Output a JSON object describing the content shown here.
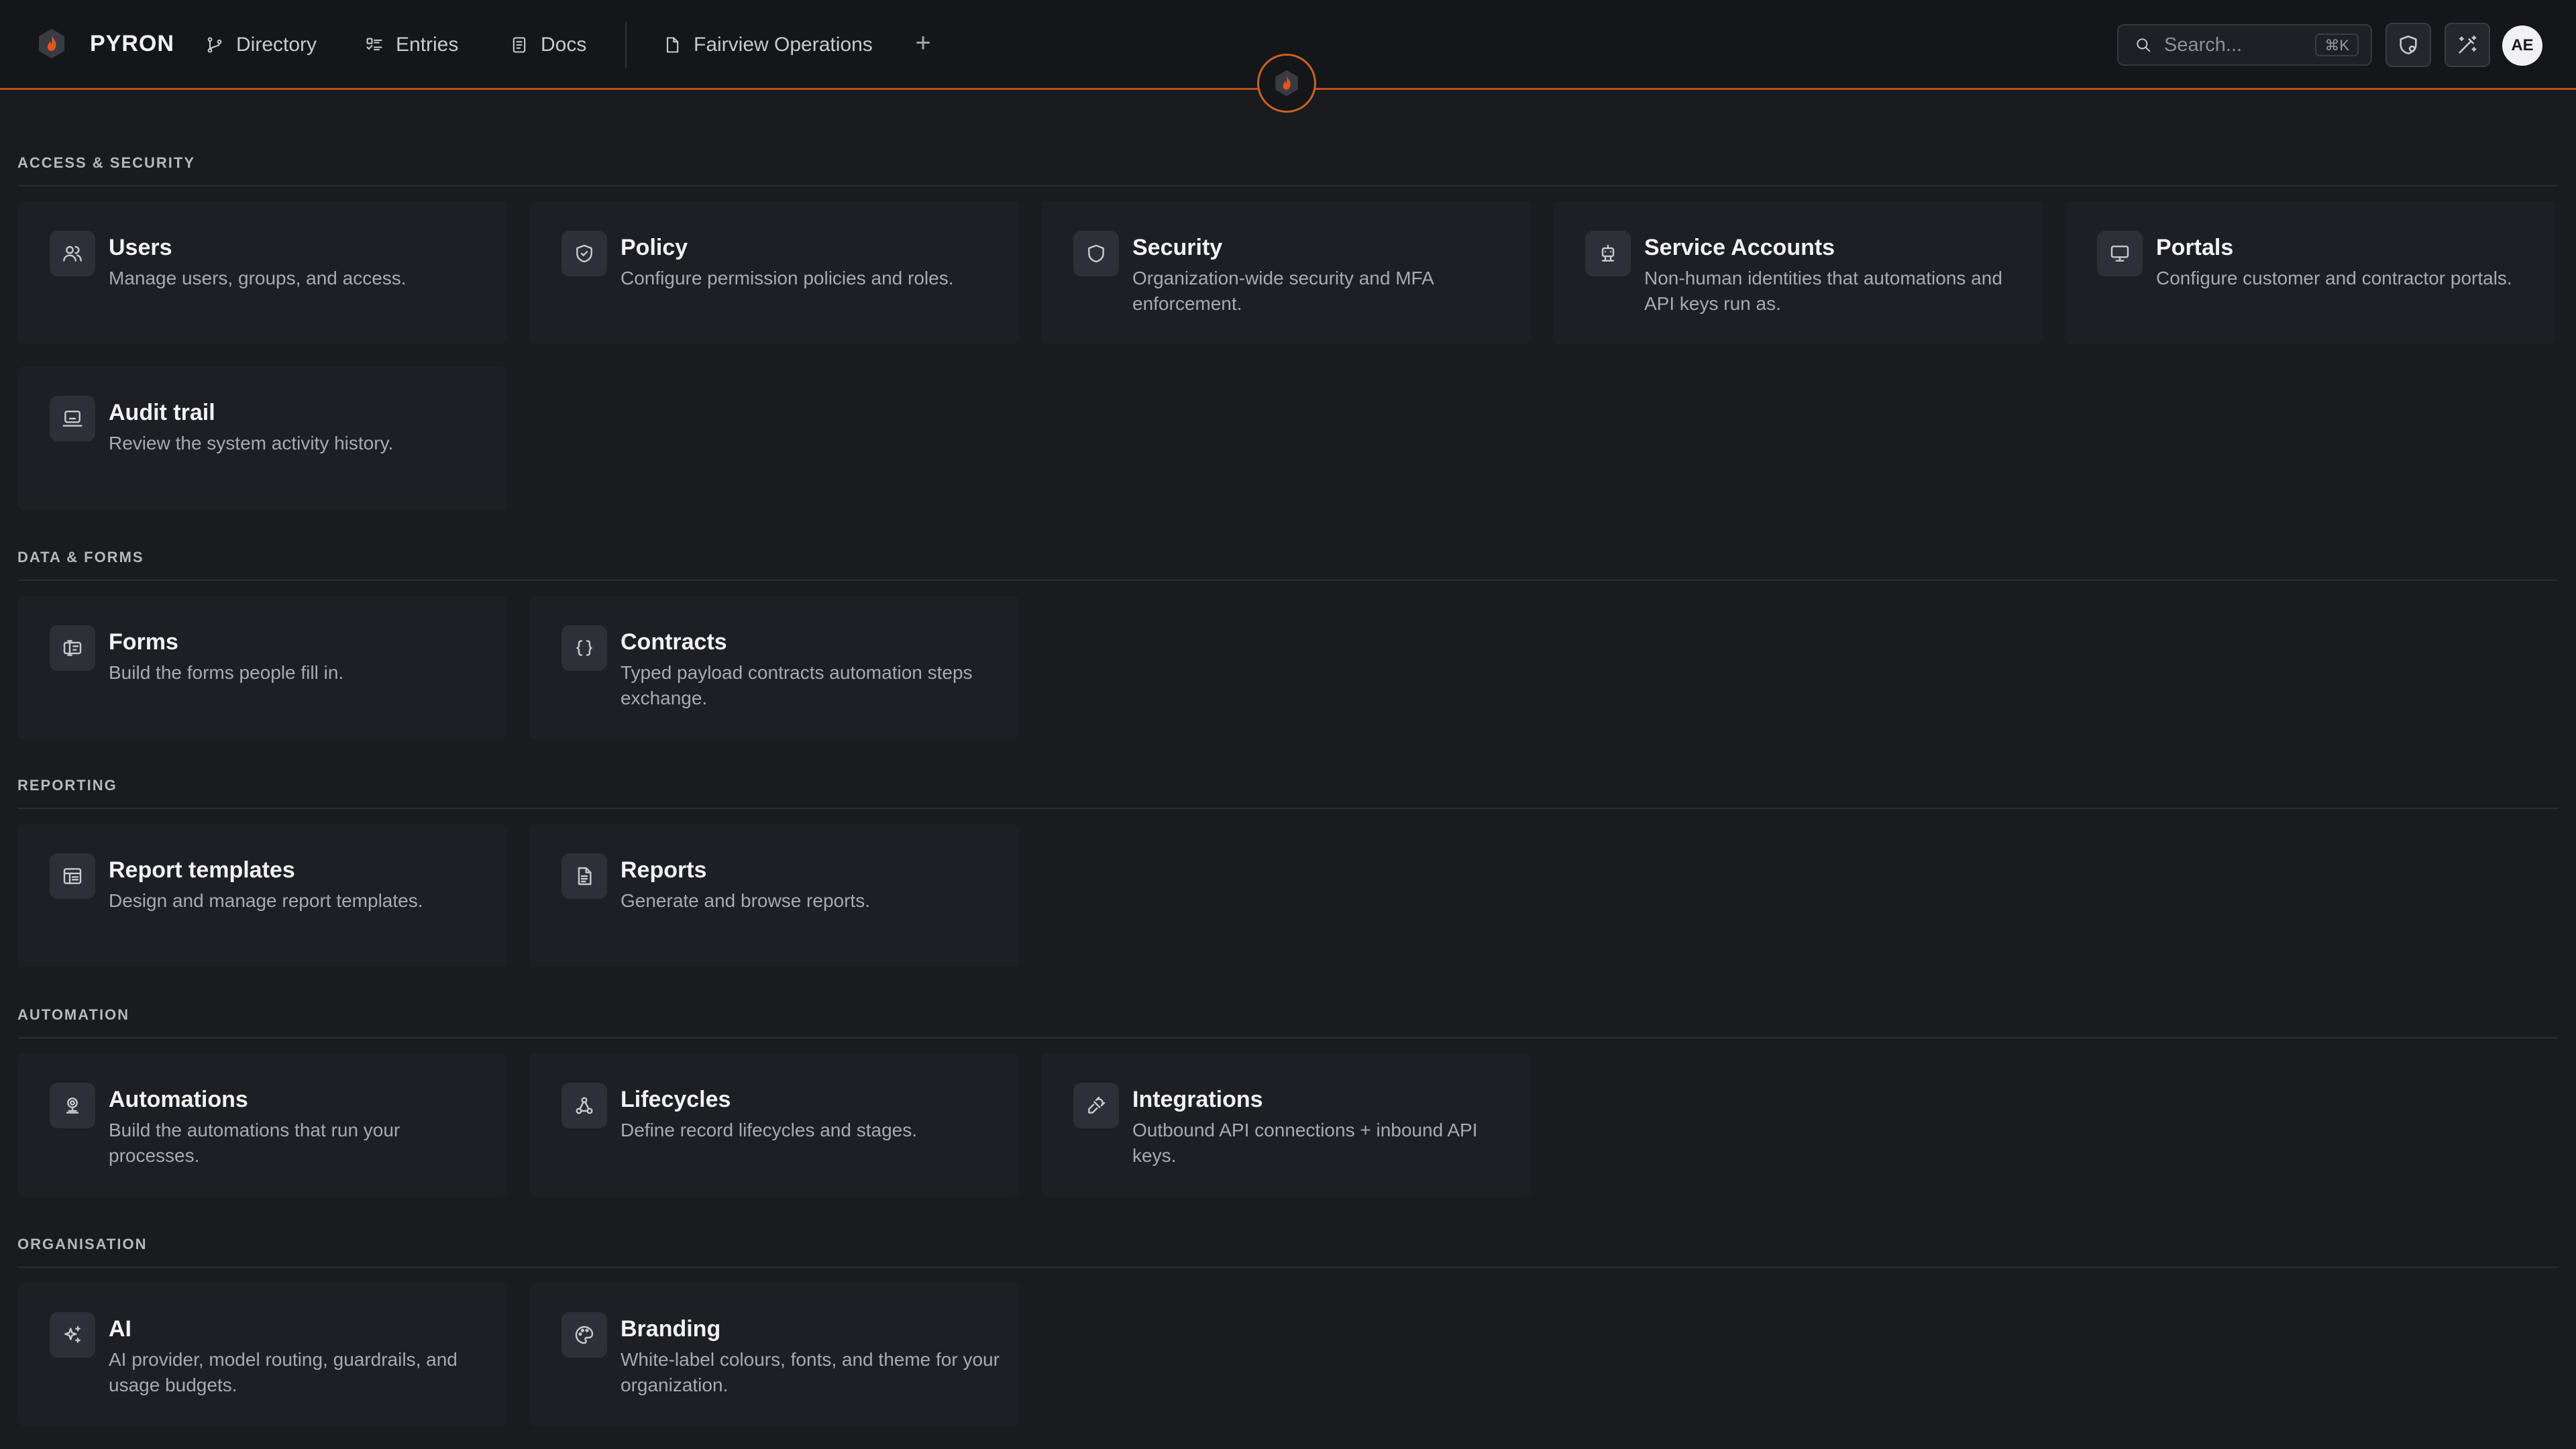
{
  "header": {
    "brand": "PYRON",
    "nav": [
      {
        "label": "Directory",
        "icon": "directory-icon"
      },
      {
        "label": "Entries",
        "icon": "entries-icon"
      },
      {
        "label": "Docs",
        "icon": "docs-icon"
      },
      {
        "label": "Fairview Operations",
        "icon": "file-icon"
      }
    ],
    "add_tab": "+",
    "search": {
      "placeholder": "Search...",
      "shortcut": "⌘K"
    },
    "avatar_initials": "AE",
    "accent_color": "#c8631f"
  },
  "sections": [
    {
      "title": "ACCESS & SECURITY",
      "cards": [
        {
          "title": "Users",
          "desc": "Manage users, groups, and access.",
          "icon": "users-icon"
        },
        {
          "title": "Policy",
          "desc": "Configure permission policies and roles.",
          "icon": "policy-shield-icon"
        },
        {
          "title": "Security",
          "desc": "Organization-wide security and MFA enforcement.",
          "icon": "shield-icon"
        },
        {
          "title": "Service Accounts",
          "desc": "Non-human identities that automations and API keys run as.",
          "icon": "robot-icon"
        },
        {
          "title": "Portals",
          "desc": "Configure customer and contractor portals.",
          "icon": "monitor-icon"
        },
        {
          "title": "Audit trail",
          "desc": "Review the system activity history.",
          "icon": "audit-icon"
        }
      ]
    },
    {
      "title": "DATA & FORMS",
      "cards": [
        {
          "title": "Forms",
          "desc": "Build the forms people fill in.",
          "icon": "form-icon"
        },
        {
          "title": "Contracts",
          "desc": "Typed payload contracts automation steps exchange.",
          "icon": "braces-icon"
        }
      ]
    },
    {
      "title": "REPORTING",
      "cards": [
        {
          "title": "Report templates",
          "desc": "Design and manage report templates.",
          "icon": "template-icon"
        },
        {
          "title": "Reports",
          "desc": "Generate and browse reports.",
          "icon": "report-icon"
        }
      ]
    },
    {
      "title": "AUTOMATION",
      "cards": [
        {
          "title": "Automations",
          "desc": "Build the automations that run your processes.",
          "icon": "automation-icon"
        },
        {
          "title": "Lifecycles",
          "desc": "Define record lifecycles and stages.",
          "icon": "lifecycle-icon"
        },
        {
          "title": "Integrations",
          "desc": "Outbound API connections + inbound API keys.",
          "icon": "plug-icon"
        }
      ]
    },
    {
      "title": "ORGANISATION",
      "cards": [
        {
          "title": "AI",
          "desc": "AI provider, model routing, guardrails, and usage budgets.",
          "icon": "sparkles-icon"
        },
        {
          "title": "Branding",
          "desc": "White-label colours, fonts, and theme for your organization.",
          "icon": "palette-icon"
        }
      ]
    }
  ]
}
